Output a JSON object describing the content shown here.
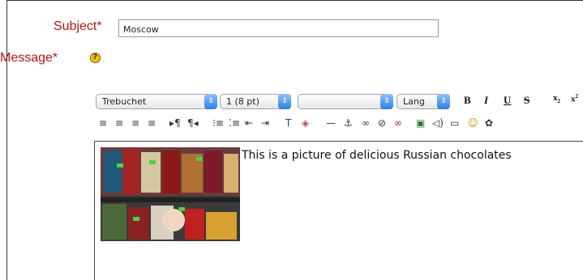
{
  "form": {
    "subject_label": "Subject",
    "subject_required": "*",
    "subject_value": "Moscow",
    "message_label": "Message",
    "message_required": "*",
    "help_symbol": "?"
  },
  "toolbar": {
    "font_family": "Trebuchet",
    "font_size": "1 (8 pt)",
    "format": "",
    "lang": "Lang",
    "bold": "B",
    "italic": "I",
    "underline": "U",
    "strike": "S"
  },
  "editor": {
    "text": "This is a picture of delicious Russian chocolates"
  },
  "colors": {
    "required_label": "#b01818",
    "select_arrow": "#2f7de0"
  }
}
